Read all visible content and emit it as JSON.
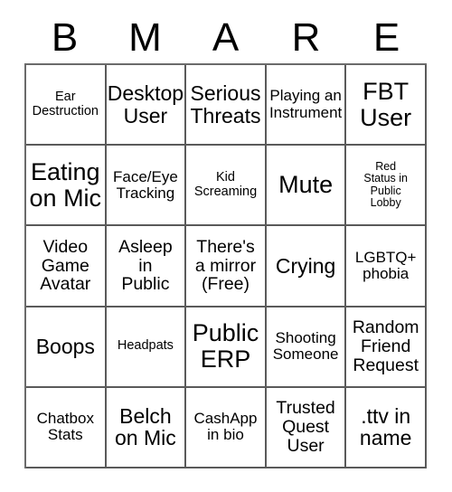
{
  "card": {
    "type": "bingo-card",
    "columns": 5,
    "rows": 5,
    "border_color": "#5a5a5a",
    "text_color": "#000000",
    "background_color": "#ffffff"
  },
  "header": {
    "letters": [
      "B",
      "M",
      "A",
      "R",
      "E"
    ]
  },
  "cells": [
    {
      "text": "Ear\nDestruction",
      "size": "s"
    },
    {
      "text": "Desktop\nUser",
      "size": "xl"
    },
    {
      "text": "Serious\nThreats",
      "size": "xl"
    },
    {
      "text": "Playing an\nInstrument",
      "size": "m"
    },
    {
      "text": "FBT\nUser",
      "size": "xxl"
    },
    {
      "text": "Eating\non Mic",
      "size": "xxl"
    },
    {
      "text": "Face/Eye\nTracking",
      "size": "m"
    },
    {
      "text": "Kid\nScreaming",
      "size": "s"
    },
    {
      "text": "Mute",
      "size": "xxl"
    },
    {
      "text": "Red\nStatus in\nPublic\nLobby",
      "size": "xs"
    },
    {
      "text": "Video\nGame\nAvatar",
      "size": "l"
    },
    {
      "text": "Asleep\nin\nPublic",
      "size": "l"
    },
    {
      "text": "There's\na mirror\n(Free)",
      "size": "l"
    },
    {
      "text": "Crying",
      "size": "xl"
    },
    {
      "text": "LGBTQ+\nphobia",
      "size": "m"
    },
    {
      "text": "Boops",
      "size": "xl"
    },
    {
      "text": "Headpats",
      "size": "s"
    },
    {
      "text": "Public\nERP",
      "size": "xxl"
    },
    {
      "text": "Shooting\nSomeone",
      "size": "m"
    },
    {
      "text": "Random\nFriend\nRequest",
      "size": "l"
    },
    {
      "text": "Chatbox\nStats",
      "size": "m"
    },
    {
      "text": "Belch\non Mic",
      "size": "xl"
    },
    {
      "text": "CashApp\nin bio",
      "size": "m"
    },
    {
      "text": "Trusted\nQuest\nUser",
      "size": "l"
    },
    {
      "text": ".ttv in\nname",
      "size": "xl"
    }
  ],
  "free_space": {
    "index": 12,
    "label": "(Free)"
  }
}
